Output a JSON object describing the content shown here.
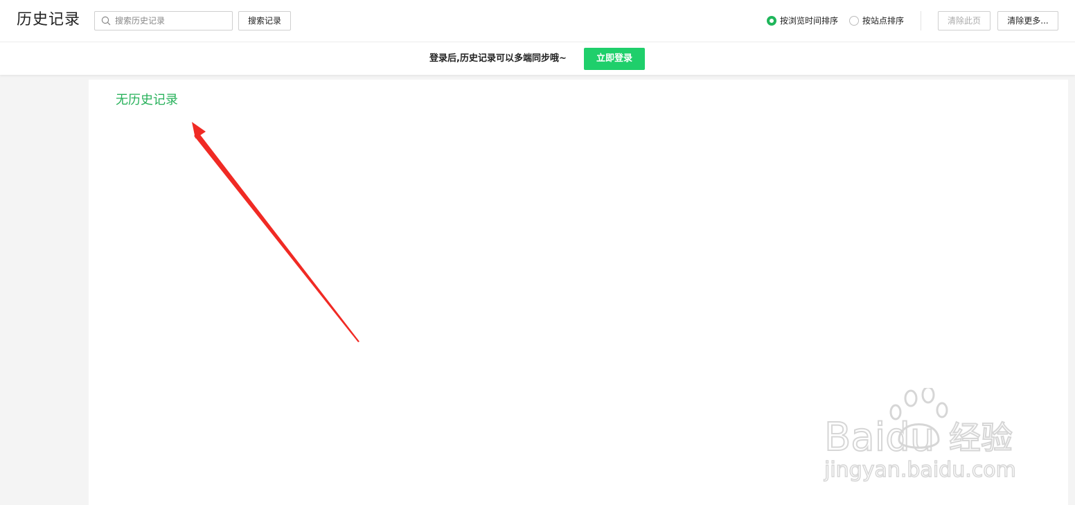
{
  "header": {
    "title": "历史记录",
    "search_placeholder": "搜索历史记录",
    "search_button": "搜索记录",
    "sort_options": [
      {
        "label": "按浏览时间排序",
        "selected": true
      },
      {
        "label": "按站点排序",
        "selected": false
      }
    ],
    "clear_page_button": "清除此页",
    "clear_more_button": "清除更多..."
  },
  "login_banner": {
    "tip": "登录后,历史记录可以多端同步哦~",
    "login_button": "立即登录"
  },
  "content": {
    "empty_message": "无历史记录"
  },
  "watermark": {
    "brand": "Baidu",
    "brand_suffix": "经验",
    "url": "jingyan.baidu.com"
  },
  "colors": {
    "accent_green": "#1fcf6b",
    "empty_text_green": "#27b15a",
    "annotation_red": "#f02a24"
  }
}
